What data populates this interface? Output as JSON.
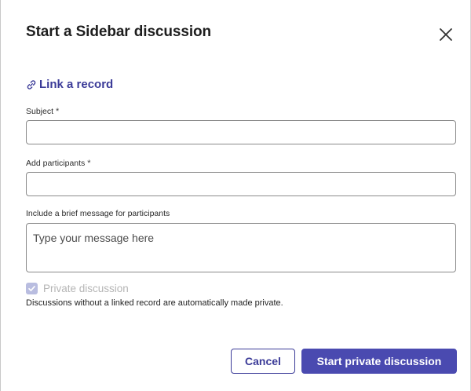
{
  "dialog": {
    "title": "Start a Sidebar discussion",
    "link_record_label": "Link a record",
    "fields": {
      "subject": {
        "label": "Subject",
        "required_mark": "*",
        "value": ""
      },
      "participants": {
        "label": "Add participants",
        "required_mark": "*",
        "value": ""
      },
      "message": {
        "label": "Include a brief message for participants",
        "placeholder": "Type your message here",
        "value": ""
      }
    },
    "private_checkbox": {
      "label": "Private discussion",
      "checked": true,
      "disabled": true
    },
    "helper_text": "Discussions without a linked record are automatically made private.",
    "buttons": {
      "cancel": "Cancel",
      "submit": "Start private discussion"
    }
  },
  "colors": {
    "accent": "#4a4ab0",
    "link": "#3b3b98",
    "checkbox_disabled": "#b9bde0"
  },
  "icons": {
    "close": "close-icon",
    "link": "link-icon",
    "check": "check-icon"
  }
}
